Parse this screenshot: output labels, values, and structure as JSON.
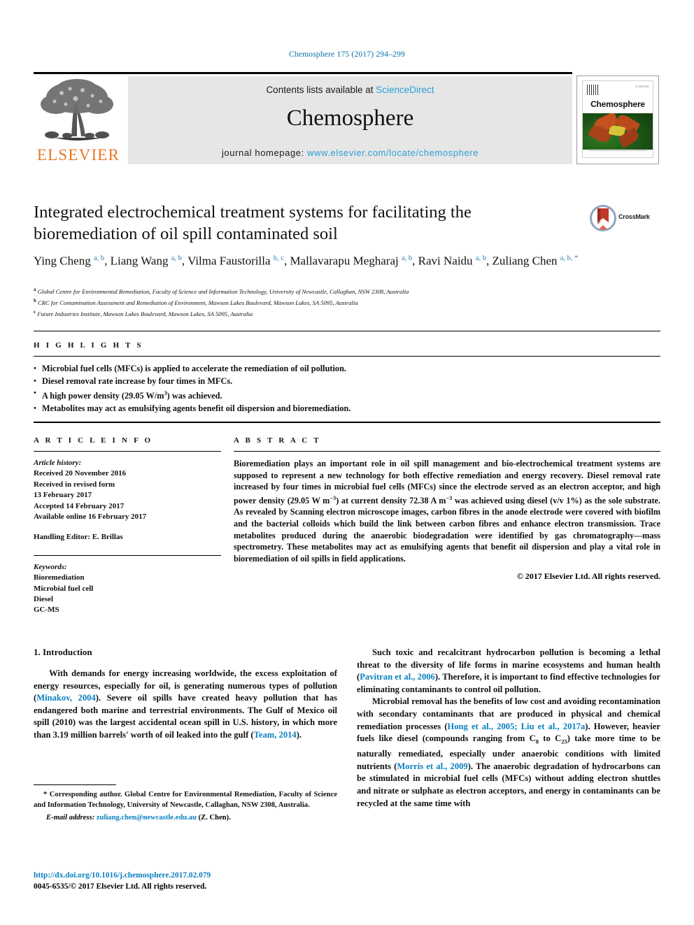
{
  "running_head": "Chemosphere 175 (2017) 294–299",
  "masthead": {
    "publisher_wordmark": "ELSEVIER",
    "contents_prefix": "Contents lists available at ",
    "contents_link": "ScienceDirect",
    "journal_title": "Chemosphere",
    "homepage_label": "journal homepage: ",
    "homepage_url": "www.elsevier.com/locate/chemosphere",
    "cover": {
      "journal_name": "Chemosphere",
      "publisher_mark": "ELSEVIER"
    }
  },
  "article": {
    "title": "Integrated electrochemical treatment systems for facilitating the bioremediation of oil spill contaminated soil",
    "crossmark_label": "CrossMark",
    "authors_html": "Ying Cheng <sup>a, b</sup>, Liang Wang <sup>a, b</sup>, Vilma Faustorilla <sup>b, c</sup>, Mallavarapu Megharaj <sup>a, b</sup>, Ravi Naidu <sup>a, b</sup>, Zuliang Chen <sup>a, b, *</sup>",
    "affiliations": [
      {
        "marker": "a",
        "text": "Global Centre for Environmental Remediation, Faculty of Science and Information Technology, University of Newcastle, Callaghan, NSW 2308, Australia"
      },
      {
        "marker": "b",
        "text": "CRC for Contamination Assessment and Remediation of Environment, Mawson Lakes Boulevard, Mawson Lakes, SA 5095, Australia"
      },
      {
        "marker": "c",
        "text": "Future Industries Institute, Mawson Lakes Boulevard, Mawson Lakes, SA 5095, Australia"
      }
    ]
  },
  "highlights": {
    "heading": "H I G H L I G H T S",
    "items_html": [
      "Microbial fuel cells (MFCs) is applied to accelerate the remediation of oil pollution.",
      "Diesel removal rate increase by four times in MFCs.",
      "A high power density (29.05 W/m<sup class=\"sp\">3</sup>) was achieved.",
      "Metabolites may act as emulsifying agents benefit oil dispersion and bioremediation."
    ]
  },
  "article_info": {
    "heading": "A R T I C L E   I N F O",
    "history_label": "Article history:",
    "history_lines": [
      "Received 20 November 2016",
      "Received in revised form",
      "13 February 2017",
      "Accepted 14 February 2017",
      "Available online 16 February 2017"
    ],
    "handling_editor": "Handling Editor: E. Brillas",
    "keywords_label": "Keywords:",
    "keywords": [
      "Bioremediation",
      "Microbial fuel cell",
      "Diesel",
      "GC-MS"
    ]
  },
  "abstract": {
    "heading": "A B S T R A C T",
    "body_html": "Bioremediation plays an important role in oil spill management and bio-electrochemical treatment systems are supposed to represent a new technology for both effective remediation and energy recovery. Diesel removal rate increased by four times in microbial fuel cells (MFCs) since the electrode served as an electron acceptor, and high power density (29.05 W m<sup class=\"sp\">&minus;3</sup>) at current density 72.38 A m<sup class=\"sp\">&minus;3</sup> was achieved using diesel (v/v 1%) as the sole substrate. As revealed by Scanning electron microscope images, carbon fibres in the anode electrode were covered with biofilm and the bacterial colloids which build the link between carbon fibres and enhance electron transmission. Trace metabolites produced during the anaerobic biodegradation were identified by gas chromatography&mdash;mass spectrometry. These metabolites may act as emulsifying agents that benefit oil dispersion and play a vital role in bioremediation of oil spills in field applications.",
    "copyright": "© 2017 Elsevier Ltd. All rights reserved."
  },
  "introduction": {
    "section_number_title": "1. Introduction",
    "left_paragraph_html": "With demands for energy increasing worldwide, the excess exploitation of energy resources, especially for oil, is generating numerous types of pollution (<span class=\"cite\">Minakov, 2004</span>). Severe oil spills have created heavy pollution that has endangered both marine and terrestrial environments. The Gulf of Mexico oil spill (2010) was the largest accidental ocean spill in U.S. history, in which more than 3.19 million barrels' worth of oil leaked into the gulf (<span class=\"cite\">Team, 2014</span>).",
    "right_paragraph_1_html": "Such toxic and recalcitrant hydrocarbon pollution is becoming a lethal threat to the diversity of life forms in marine ecosystems and human health (<span class=\"cite\">Pavitran et al., 2006</span>). Therefore, it is important to find effective technologies for eliminating contaminants to control oil pollution.",
    "right_paragraph_2_html": "Microbial removal has the benefits of low cost and avoiding recontamination with secondary contaminants that are produced in physical and chemical remediation processes (<span class=\"cite\">Hong et al., 2005; Liu et al., 2017a</span>). However, heavier fuels like diesel (compounds ranging from C<sub class=\"sb\">8</sub> to C<sub class=\"sb\">25</sub>) take more time to be naturally remediated, especially under anaerobic conditions with limited nutrients (<span class=\"cite\">Morris et al., 2009</span>). The anaerobic degradation of hydrocarbons can be stimulated in microbial fuel cells (MFCs) without adding electron shuttles and nitrate or sulphate as electron acceptors, and energy in contaminants can be recycled at the same time with"
  },
  "footnote": {
    "corresponding_html": "* Corresponding author. Global Centre for Environmental Remediation, Faculty of Science and Information Technology, University of Newcastle, Callaghan, NSW 2308, Australia.",
    "email_label": "E-mail address:",
    "email": "zuliang.chen@newcastle.edu.au",
    "email_suffix": "(Z. Chen)."
  },
  "doi_block": {
    "doi_url": "http://dx.doi.org/10.1016/j.chemosphere.2017.02.079",
    "issn_line": "0045-6535/© 2017 Elsevier Ltd. All rights reserved."
  },
  "colors": {
    "link_blue": "#0b7fbf",
    "sciencedirect_blue": "#2a9fd6",
    "elsevier_orange": "#E87722",
    "banner_gray": "#e6e6e6"
  }
}
